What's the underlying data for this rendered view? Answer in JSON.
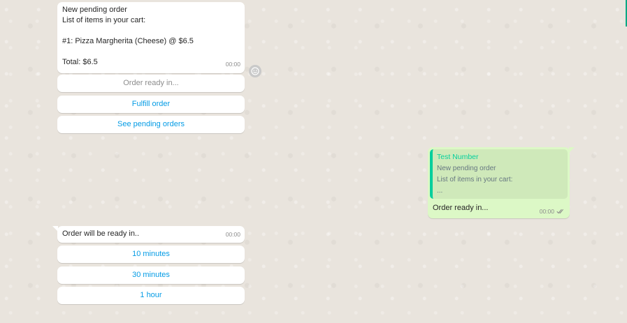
{
  "messages": {
    "incoming_1": {
      "text": "New pending order\nList of items in your cart:\n\n#1: Pizza Margherita (Cheese) @ $6.5\n\nTotal: $6.5",
      "time": "00:00",
      "buttons": [
        {
          "label": "Order ready in..."
        },
        {
          "label": "Fulfill order"
        },
        {
          "label": "See pending orders"
        }
      ]
    },
    "outgoing_1": {
      "quoted_author": "Test Number",
      "quoted_text": "New pending order\nList of items in your cart:\n...",
      "text": "Order ready in...",
      "time": "00:00"
    },
    "incoming_2": {
      "text": "Order will be ready in..",
      "time": "00:00",
      "buttons": [
        {
          "label": "10 minutes"
        },
        {
          "label": "30 minutes"
        },
        {
          "label": "1 hour"
        }
      ]
    }
  },
  "colors": {
    "chat_background": "#e9e4dd",
    "incoming_bubble": "#ffffff",
    "outgoing_bubble": "#dcf8c6",
    "button_text": "#039be5",
    "quote_accent": "#06cf9c"
  },
  "icons": {
    "emoji": "emoji-smile-icon",
    "read_receipt": "double-check-icon"
  }
}
